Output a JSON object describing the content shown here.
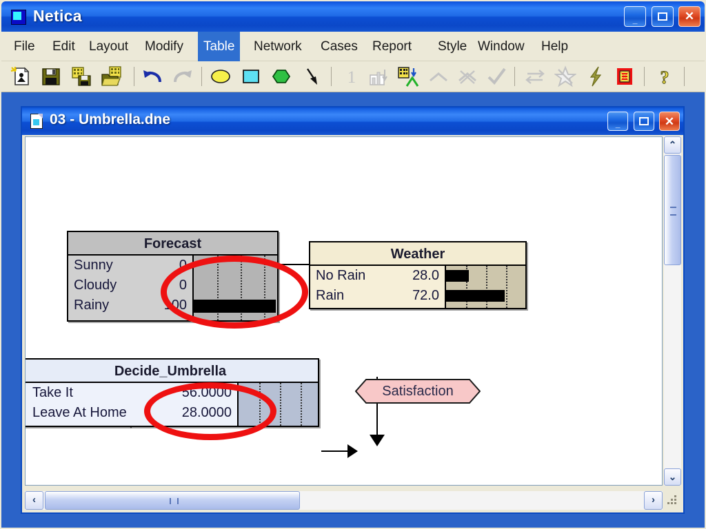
{
  "app": {
    "title": "Netica",
    "title_icon": "netica-app-icon"
  },
  "window_controls": {
    "minimize": "_",
    "maximize": "□",
    "close": "✕"
  },
  "menubar": {
    "items": [
      {
        "label": "File",
        "active": false
      },
      {
        "label": "Edit",
        "active": false
      },
      {
        "label": "Layout",
        "active": false
      },
      {
        "label": "Modify",
        "active": false
      },
      {
        "label": "Table",
        "active": true
      },
      {
        "label": "Network",
        "active": false
      },
      {
        "label": "Cases",
        "active": false
      },
      {
        "label": "Report",
        "active": false
      },
      {
        "label": "Style",
        "active": false
      },
      {
        "label": "Window",
        "active": false
      },
      {
        "label": "Help",
        "active": false
      }
    ]
  },
  "toolbar": {
    "buttons": [
      {
        "icon": "new-network-icon",
        "enabled": true
      },
      {
        "icon": "save-icon",
        "enabled": true
      },
      {
        "icon": "save-as-icon",
        "enabled": true
      },
      {
        "icon": "open-folder-icon",
        "enabled": true
      },
      {
        "icon": "undo-icon",
        "enabled": true
      },
      {
        "icon": "redo-icon",
        "enabled": false
      },
      {
        "icon": "nature-node-icon",
        "enabled": true
      },
      {
        "icon": "decision-node-icon",
        "enabled": true
      },
      {
        "icon": "utility-node-icon",
        "enabled": true
      },
      {
        "icon": "link-arrow-icon",
        "enabled": true
      },
      {
        "icon": "constant-one-icon",
        "enabled": false
      },
      {
        "icon": "chart-table-icon",
        "enabled": false
      },
      {
        "icon": "table-compile-icon",
        "enabled": true
      },
      {
        "icon": "up-arrow-icon",
        "enabled": false
      },
      {
        "icon": "cut-links-icon",
        "enabled": false
      },
      {
        "icon": "checkmark-icon",
        "enabled": false
      },
      {
        "icon": "reverse-link-icon",
        "enabled": false
      },
      {
        "icon": "absorb-node-icon",
        "enabled": false
      },
      {
        "icon": "compile-lightning-icon",
        "enabled": true
      },
      {
        "icon": "solve-decision-icon",
        "enabled": true
      },
      {
        "icon": "help-question-icon",
        "enabled": true
      }
    ]
  },
  "document_window": {
    "title": "03 - Umbrella.dne",
    "icon": "document-icon"
  },
  "network": {
    "nodes": [
      {
        "id": "forecast",
        "name": "Forecast",
        "type": "nature",
        "rows": [
          {
            "label": "Sunny",
            "value": "0",
            "bar_pct": 0
          },
          {
            "label": "Cloudy",
            "value": "0",
            "bar_pct": 0
          },
          {
            "label": "Rainy",
            "value": "100",
            "bar_pct": 100
          }
        ]
      },
      {
        "id": "weather",
        "name": "Weather",
        "type": "nature",
        "rows": [
          {
            "label": "No Rain",
            "value": "28.0",
            "bar_pct": 28
          },
          {
            "label": "Rain",
            "value": "72.0",
            "bar_pct": 72
          }
        ]
      },
      {
        "id": "decide_umbrella",
        "name": "Decide_Umbrella",
        "type": "decision",
        "rows": [
          {
            "label": "Take It",
            "value": "56.0000",
            "bar_pct": 0
          },
          {
            "label": "Leave At Home",
            "value": "28.0000",
            "bar_pct": 0
          }
        ]
      },
      {
        "id": "satisfaction",
        "name": "Satisfaction",
        "type": "utility"
      }
    ],
    "links": [
      {
        "from": "weather",
        "to": "forecast",
        "direction": "left"
      },
      {
        "from": "forecast",
        "to": "decide_umbrella",
        "direction": "down"
      },
      {
        "from": "weather",
        "to": "satisfaction",
        "direction": "down"
      },
      {
        "from": "decide_umbrella",
        "to": "satisfaction",
        "direction": "right"
      }
    ],
    "annotations": [
      {
        "shape": "ellipse",
        "color": "#ee1111",
        "target": "forecast-rainy-value"
      },
      {
        "shape": "ellipse",
        "color": "#ee1111",
        "target": "decide-umbrella-values"
      }
    ]
  },
  "scrollbars": {
    "vertical": {
      "up": "⌃",
      "down": "⌄"
    },
    "horizontal": {
      "left": "‹",
      "right": "›"
    }
  }
}
